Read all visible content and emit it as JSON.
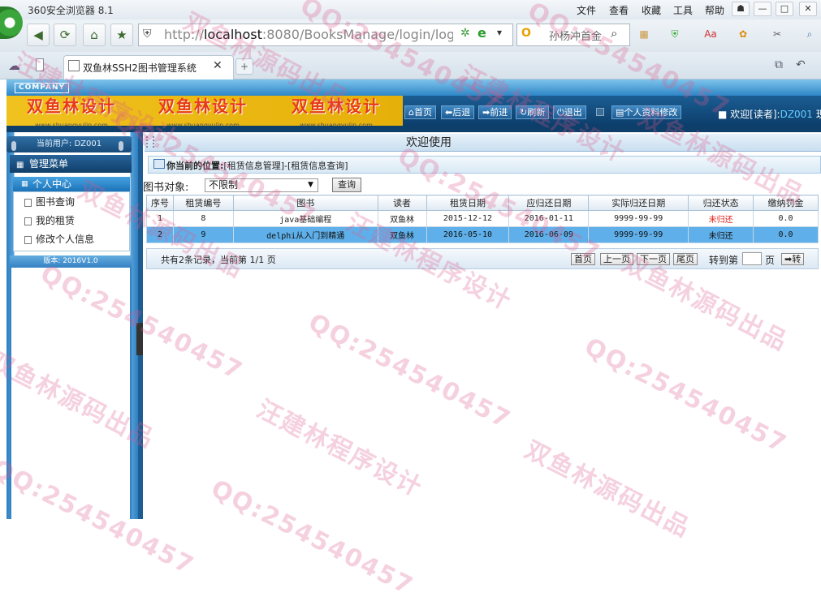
{
  "browser": {
    "app_title": "360安全浏览器 8.1",
    "menu": [
      "文件",
      "查看",
      "收藏",
      "工具",
      "帮助"
    ],
    "address": "http://localhost:8080/BooksManage/login/login_Cl",
    "address_host": "localhost",
    "address_scheme": "http://",
    "address_rest": ":8080/BooksManage/login/login_Cl",
    "search_text": "孙杨冲首金",
    "tab_title": "双鱼林SSH2图书管理系统"
  },
  "header": {
    "company": "COMPANY",
    "banner_text": "双鱼林设计",
    "banner_url": "www.shuangyulin.com",
    "nav": [
      "首页",
      "后退",
      "前进",
      "刷新",
      "退出",
      "个人资料修改"
    ],
    "welcome_prefix": "欢迎[读者]:",
    "welcome_user": "DZ001",
    "welcome_suffix": "现在"
  },
  "sidebar": {
    "current_user_label": "当前用户: DZ001",
    "menu_title": "管理菜单",
    "personal_center": "个人中心",
    "items": [
      {
        "label": "图书查询"
      },
      {
        "label": "我的租赁"
      },
      {
        "label": "修改个人信息"
      }
    ],
    "version": "版本: 2016V1.0"
  },
  "main": {
    "title": "欢迎使用",
    "location_label": "你当前的位置:",
    "location_path": "[租赁信息管理]-[租赁信息查询]",
    "filter_label": "图书对象:",
    "filter_value": "不限制",
    "query_button": "查询",
    "columns": [
      "序号",
      "租赁编号",
      "图书",
      "读者",
      "租赁日期",
      "应归还日期",
      "实际归还日期",
      "归还状态",
      "缴纳罚金"
    ],
    "rows": [
      [
        "1",
        "8",
        "java基础编程",
        "双鱼林",
        "2015-12-12",
        "2016-01-11",
        "9999-99-99",
        "未归还",
        "0.0"
      ],
      [
        "2",
        "9",
        "delphi从入门到精通",
        "双鱼林",
        "2016-05-10",
        "2016-06-09",
        "9999-99-99",
        "未归还",
        "0.0"
      ]
    ],
    "pager_info": "共有2条记录，当前第 1/1 页",
    "pager_buttons": [
      "首页",
      "上一页",
      "下一页",
      "尾页"
    ],
    "jump_label": "转到第",
    "jump_page_suffix": "页",
    "jump_button": "➡转"
  },
  "watermarks": {
    "qq": "QQ:254540457",
    "author": "汪建林程序设计",
    "source": "双鱼林源码出品"
  }
}
